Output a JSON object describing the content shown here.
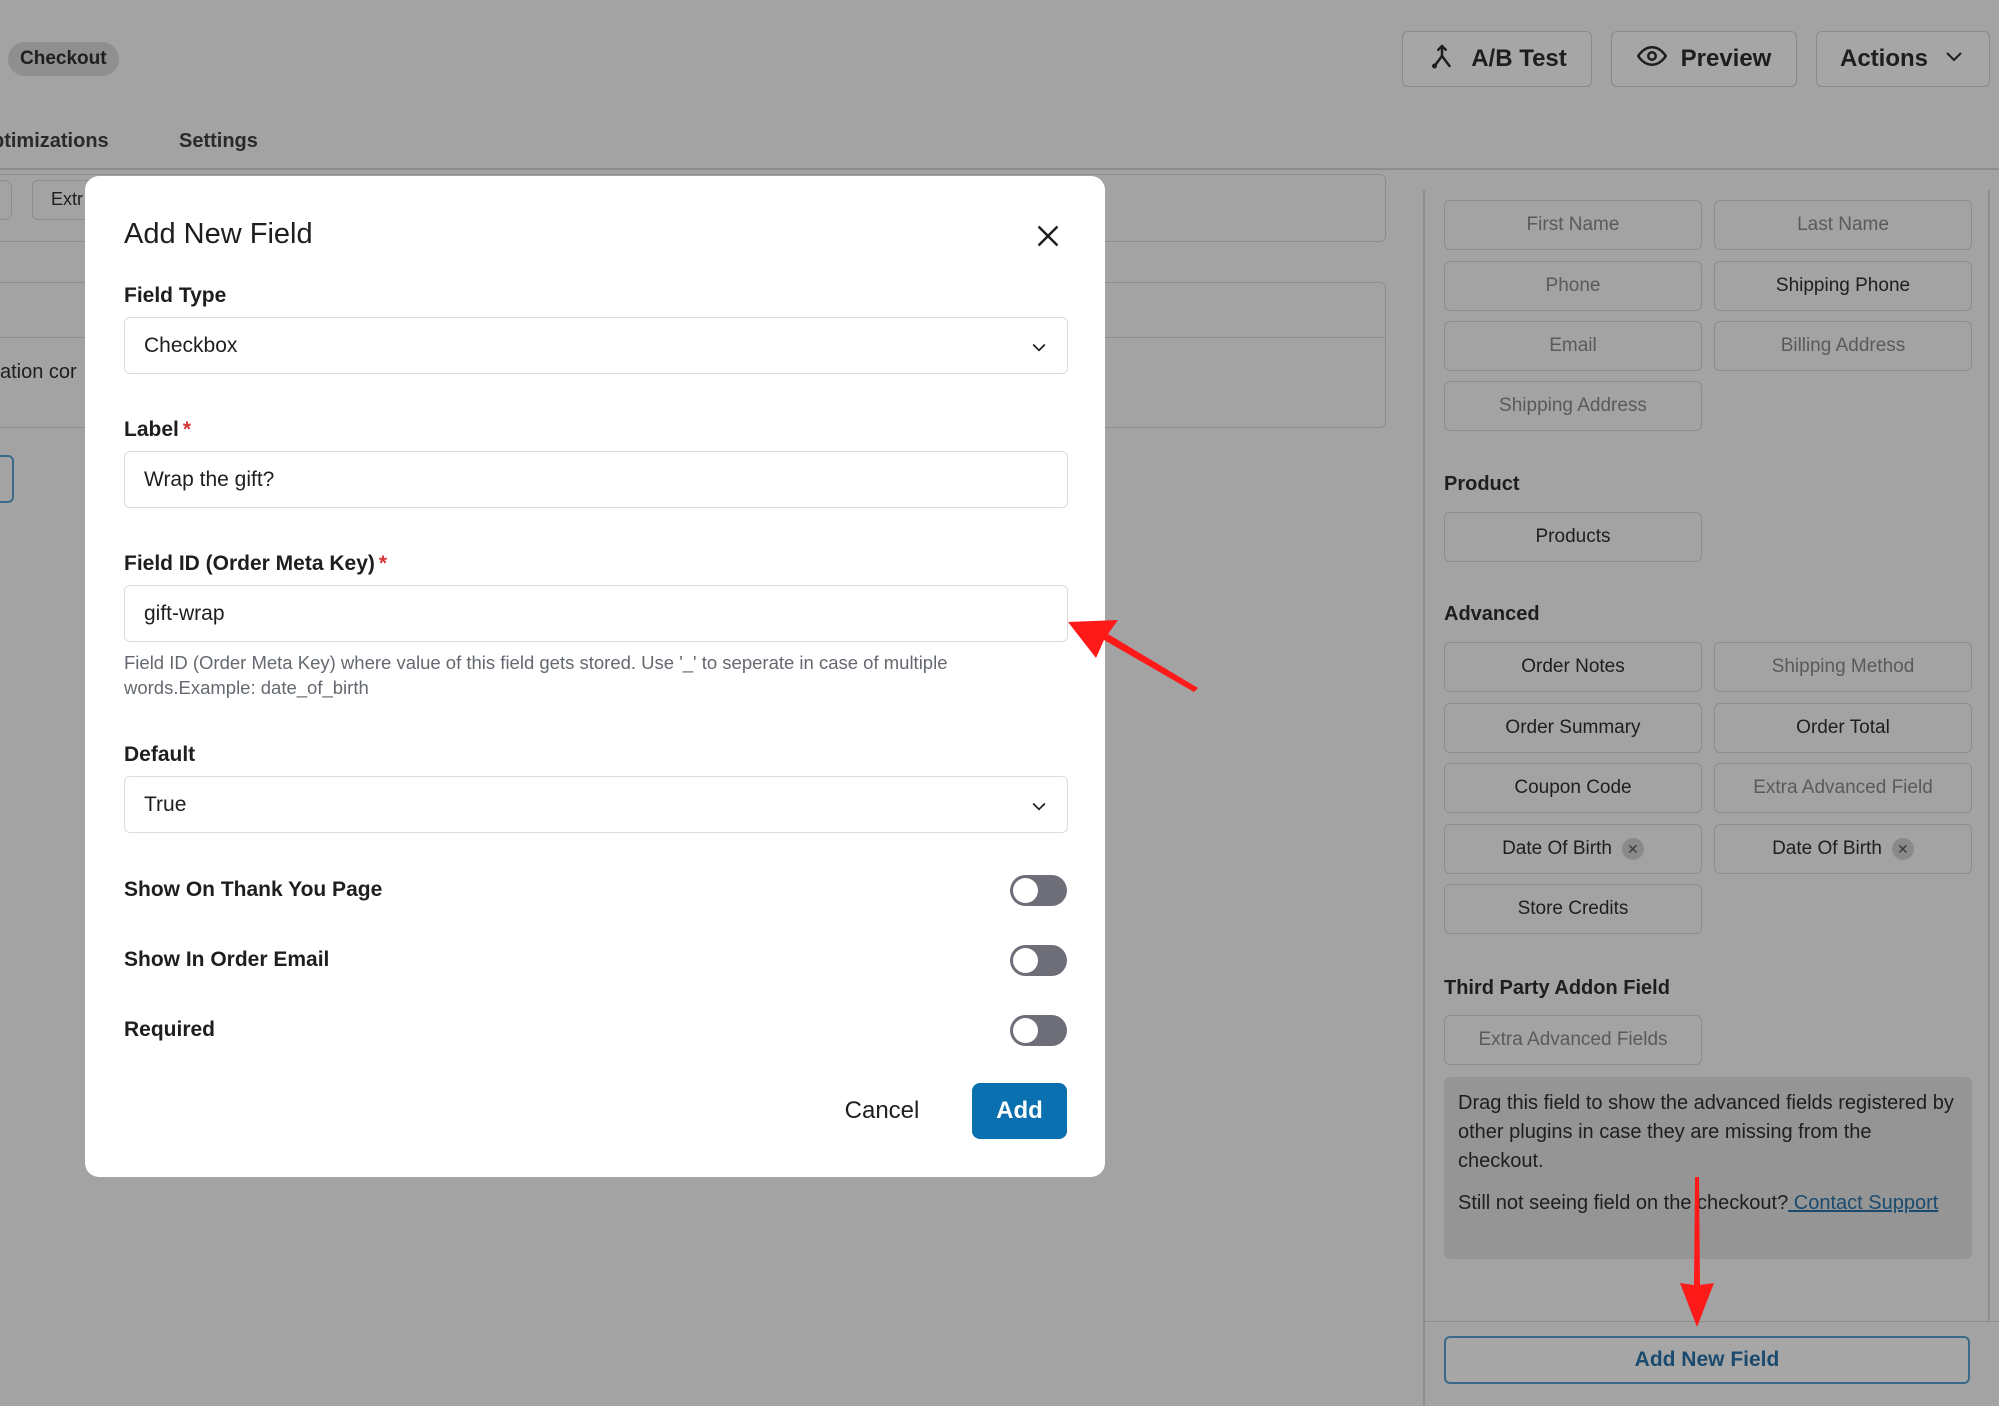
{
  "header": {
    "page_tag": "Checkout",
    "ab_test_label": "A/B Test",
    "preview_label": "Preview",
    "actions_label": "Actions"
  },
  "tabs": [
    {
      "label": "ptimizations"
    },
    {
      "label": "Settings"
    }
  ],
  "background": {
    "chip_fragment": "Extr",
    "text_fragment": "ation cor"
  },
  "sidebar": {
    "basic_chips": [
      {
        "label": "First Name",
        "state": "used"
      },
      {
        "label": "Last Name",
        "state": "used"
      },
      {
        "label": "Phone",
        "state": "used"
      },
      {
        "label": "Shipping Phone",
        "state": "available"
      },
      {
        "label": "Email",
        "state": "used"
      },
      {
        "label": "Billing Address",
        "state": "used"
      },
      {
        "label": "Shipping Address",
        "state": "used"
      }
    ],
    "product_title": "Product",
    "product_chips": [
      {
        "label": "Products",
        "state": "available"
      }
    ],
    "advanced_title": "Advanced",
    "advanced_chips": [
      {
        "label": "Order Notes",
        "state": "available"
      },
      {
        "label": "Shipping Method",
        "state": "used"
      },
      {
        "label": "Order Summary",
        "state": "available"
      },
      {
        "label": "Order Total",
        "state": "available"
      },
      {
        "label": "Coupon Code",
        "state": "available"
      },
      {
        "label": "Extra Advanced Field",
        "state": "used"
      },
      {
        "label": "Date Of Birth",
        "state": "available",
        "removable": true
      },
      {
        "label": "Date Of Birth",
        "state": "available",
        "removable": true
      },
      {
        "label": "Store Credits",
        "state": "available"
      }
    ],
    "third_party_title": "Third Party Addon Field",
    "third_party_chips": [
      {
        "label": "Extra Advanced Fields",
        "state": "used"
      }
    ],
    "info_text": "Drag this field to show the advanced fields registered by other plugins in case they are missing from the checkout.",
    "info_support_prefix": "Still not seeing field on the checkout?",
    "info_support_link": " Contact Support",
    "add_new_field_label": "Add New Field"
  },
  "modal": {
    "title": "Add New Field",
    "field_type_label": "Field Type",
    "field_type_value": "Checkbox",
    "label_label": "Label",
    "label_value": "Wrap the gift?",
    "field_id_label": "Field ID (Order Meta Key)",
    "field_id_value": "gift-wrap",
    "field_id_help": "Field ID (Order Meta Key) where value of this field gets stored. Use '_' to seperate in case of multiple words.Example: date_of_birth",
    "default_label": "Default",
    "default_value": "True",
    "required_marker": "*",
    "toggles": [
      {
        "label": "Show On Thank You Page",
        "on": false
      },
      {
        "label": "Show In Order Email",
        "on": false
      },
      {
        "label": "Required",
        "on": false
      }
    ],
    "cancel_label": "Cancel",
    "add_label": "Add"
  },
  "colors": {
    "overlay": "#a3a3a3",
    "primary": "#0a70b0",
    "required": "#d63638",
    "annotation_arrow": "#ff1a1a"
  }
}
